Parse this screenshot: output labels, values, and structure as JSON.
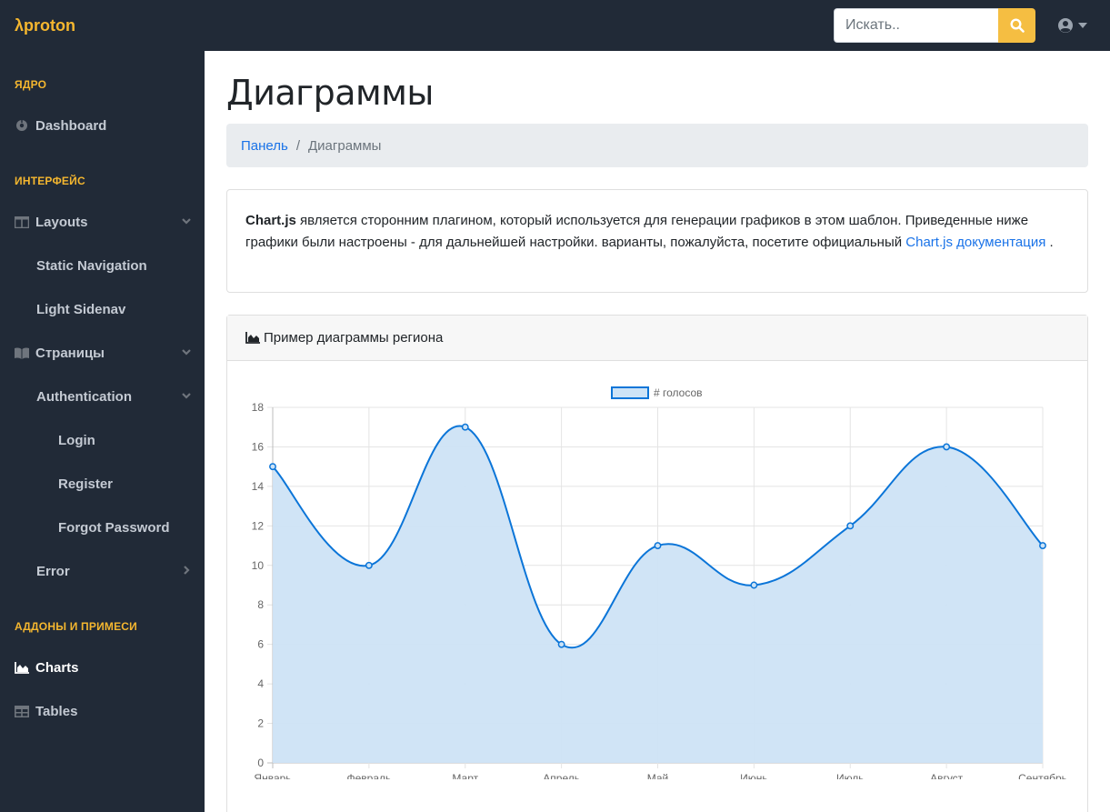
{
  "brand": "λproton",
  "search": {
    "placeholder": "Искать..",
    "icon": "search-icon"
  },
  "user_menu": {
    "icon": "user-circle-icon"
  },
  "sidebar": {
    "headings": [
      "ЯДРО",
      "ИНТЕРФЕЙС",
      "АДДОНЫ И ПРИМЕСИ"
    ],
    "items": [
      {
        "label": "Dashboard",
        "icon": "tachometer-icon"
      },
      {
        "label": "Layouts",
        "icon": "columns-icon"
      },
      {
        "label": "Static Navigation"
      },
      {
        "label": "Light Sidenav"
      },
      {
        "label": "Страницы",
        "icon": "book-open-icon"
      },
      {
        "label": "Authentication"
      },
      {
        "label": "Login"
      },
      {
        "label": "Register"
      },
      {
        "label": "Forgot Password"
      },
      {
        "label": "Error"
      },
      {
        "label": "Charts",
        "icon": "chart-area-icon"
      },
      {
        "label": "Tables",
        "icon": "table-icon"
      }
    ]
  },
  "page": {
    "title": "Диаграммы",
    "breadcrumb": {
      "link": "Панель",
      "current": "Диаграммы"
    }
  },
  "info": {
    "strong": "Chart.js",
    "text1": " является сторонним плагином, который используется для генерации графиков в этом шаблон. Приведенные ниже графики были настроены - для дальнейшей настройки. варианты, пожалуйста, посетите официальный ",
    "link": "Chart.js документация",
    "text2": " ."
  },
  "chart_card": {
    "header": "Пример диаграммы региона"
  },
  "colors": {
    "accent": "#f5b72f",
    "nav_bg": "#212a37",
    "line": "#0b75d8",
    "fill": "#cde3f6"
  },
  "chart_data": {
    "type": "area",
    "categories": [
      "Январь",
      "Февраль",
      "Март",
      "Апрель",
      "Май",
      "Июнь",
      "Июль",
      "Август",
      "Сентябрь"
    ],
    "series": [
      {
        "name": "# голосов",
        "values": [
          15,
          10,
          17,
          6,
          11,
          9,
          12,
          16,
          11
        ]
      }
    ],
    "ylim": [
      0,
      18
    ],
    "yticks": [
      0,
      2,
      4,
      6,
      8,
      10,
      12,
      14,
      16,
      18
    ],
    "grid": true,
    "legend": "top"
  }
}
